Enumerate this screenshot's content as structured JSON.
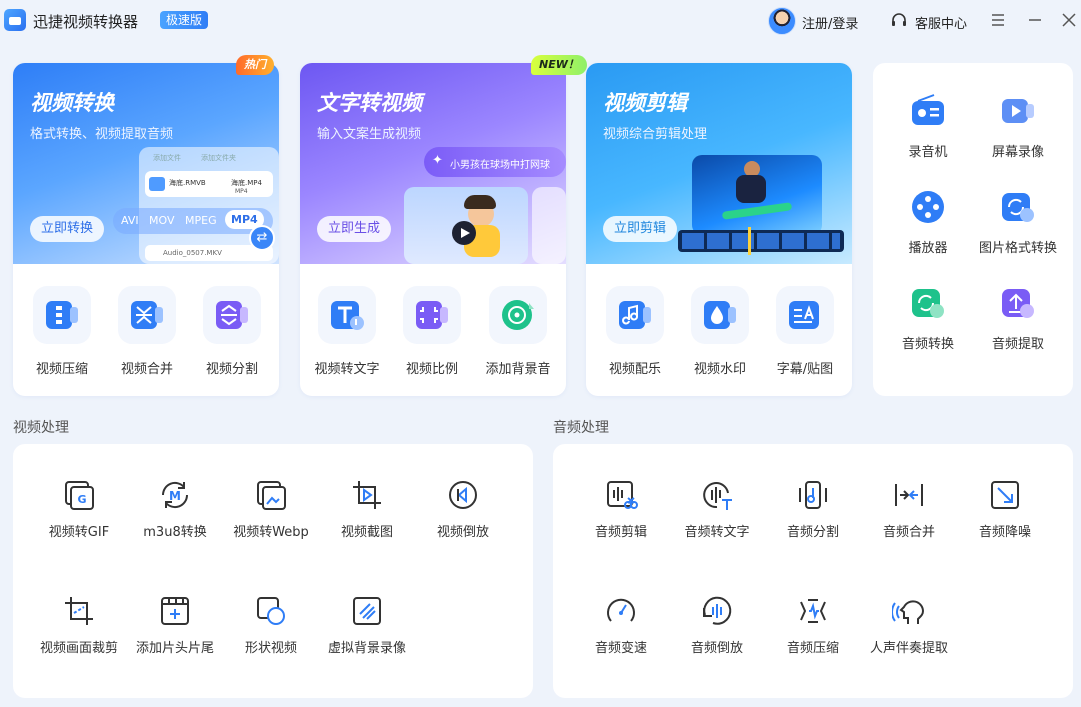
{
  "app": {
    "title": "迅捷视频转换器",
    "edition": "极速版"
  },
  "header": {
    "login": "注册/登录",
    "support": "客服中心"
  },
  "cards": [
    {
      "title": "视频转换",
      "subtitle": "格式转换、视频提取音频",
      "button": "立即转换",
      "badge": "热门",
      "illus_tabs": [
        "添加文件",
        "添加文件夹"
      ],
      "illus_files": [
        "海底.RMVB",
        "海底.MP4",
        "Audio_0507.MKV"
      ],
      "illus_dropdown": "MP4",
      "formats": [
        "AVI",
        "MOV",
        "MPEG",
        "MP4"
      ],
      "tools": [
        "视频压缩",
        "视频合并",
        "视频分割"
      ]
    },
    {
      "title": "文字转视频",
      "subtitle": "输入文案生成视频",
      "button": "立即生成",
      "badge": "NEW！",
      "prompt": "小男孩在球场中打网球",
      "tools": [
        "视频转文字",
        "视频比例",
        "添加背景音"
      ]
    },
    {
      "title": "视频剪辑",
      "subtitle": "视频综合剪辑处理",
      "button": "立即剪辑",
      "tools": [
        "视频配乐",
        "视频水印",
        "字幕/贴图"
      ]
    }
  ],
  "side_tools": [
    "录音机",
    "屏幕录像",
    "播放器",
    "图片格式转换",
    "音频转换",
    "音频提取"
  ],
  "video_section": {
    "title": "视频处理",
    "items": [
      "视频转GIF",
      "m3u8转换",
      "视频转Webp",
      "视频截图",
      "视频倒放",
      "视频画面裁剪",
      "添加片头片尾",
      "形状视频",
      "虚拟背景录像"
    ]
  },
  "audio_section": {
    "title": "音频处理",
    "items": [
      "音频剪辑",
      "音频转文字",
      "音频分割",
      "音频合并",
      "音频降噪",
      "音频变速",
      "音频倒放",
      "音频压缩",
      "人声伴奏提取"
    ]
  },
  "colors": {
    "accent": "#2f7df6",
    "icon_blue": "#1e6ff0",
    "purple": "#7a5cf5",
    "green": "#1ec28b"
  }
}
